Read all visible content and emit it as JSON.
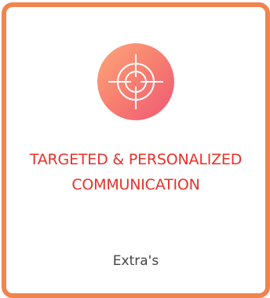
{
  "card": {
    "icon": "crosshair-target-icon",
    "title_line1": "TARGETED & PERSONALIZED",
    "title_line2": "COMMUNICATION",
    "footer_label": "Extra's"
  },
  "colors": {
    "border": "#f0844f",
    "title": "#e8312a",
    "footer": "#444444",
    "icon_gradient_start": "#fca77a",
    "icon_gradient_end": "#ee5876"
  }
}
